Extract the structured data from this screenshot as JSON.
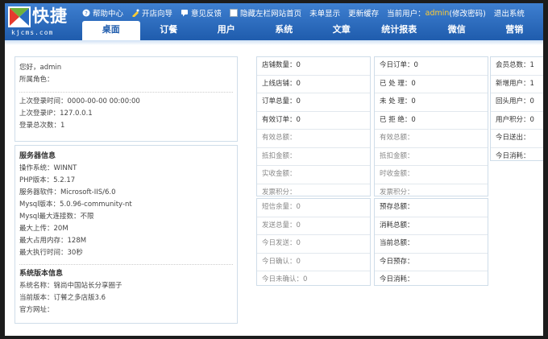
{
  "logo": {
    "name": "快捷",
    "sub": "kjcms.com"
  },
  "toplinks": [
    {
      "label": "帮助中心",
      "icon": "help-icon"
    },
    {
      "label": "开店向导",
      "icon": "wizard-icon"
    },
    {
      "label": "意见反馈",
      "icon": "feedback-icon"
    },
    {
      "label": "隐藏左栏",
      "icon": "checkbox-icon"
    },
    {
      "label": "网站首页"
    },
    {
      "label": "未单显示"
    },
    {
      "label": "更新缓存"
    }
  ],
  "user": {
    "prefix": "当前用户：",
    "name": "admin",
    "change_pwd": "(修改密码)",
    "logout": "退出系统"
  },
  "nav": [
    "桌面",
    "订餐",
    "用户",
    "系统",
    "文章",
    "统计报表",
    "微信",
    "营销"
  ],
  "welcome": {
    "greeting": "您好，admin",
    "role": "所属角色：",
    "last_login_time": "上次登录时间：0000-00-00 00:00:00",
    "last_login_ip": "上次登录IP：127.0.0.1",
    "login_count": "登录总次数：1"
  },
  "server": {
    "title": "服务器信息",
    "lines": [
      "操作系统：WINNT",
      "PHP版本：5.2.17",
      "服务器软件：Microsoft-IIS/6.0",
      "Mysql版本：5.0.96-community-nt",
      "Mysql最大连接数：不限",
      "最大上传：20M",
      "最大占用内存：128M",
      "最大执行时间：30秒"
    ]
  },
  "system": {
    "title": "系统版本信息",
    "lines": [
      "系统名称：锦尚中国站长分享圈子",
      "当前版本：订餐之多店版3.6",
      "官方网址："
    ]
  },
  "stats1": [
    {
      "label": "店铺数量：0",
      "dim": false
    },
    {
      "label": "上线店铺：0",
      "dim": false
    },
    {
      "label": "订单总量：0",
      "dim": false
    },
    {
      "label": "有效订单：0",
      "dim": false
    },
    {
      "label": "有效总额：",
      "dim": true
    },
    {
      "label": "抵扣金额：",
      "dim": true
    },
    {
      "label": "实收金额：",
      "dim": true
    },
    {
      "label": "发票积分：",
      "dim": true
    }
  ],
  "stats2": [
    {
      "label": "今日订单：0",
      "dim": false
    },
    {
      "label": "已 处 理：0",
      "dim": false
    },
    {
      "label": "未 处 理：0",
      "dim": false
    },
    {
      "label": "已 拒 绝：0",
      "dim": false
    },
    {
      "label": "有效总额：",
      "dim": true
    },
    {
      "label": "抵扣金额：",
      "dim": true
    },
    {
      "label": "时收金额：",
      "dim": true
    },
    {
      "label": "发票积分：",
      "dim": true
    }
  ],
  "stats3": [
    {
      "label": "会员总数：1",
      "dim": false
    },
    {
      "label": "新增用户：1",
      "dim": false
    },
    {
      "label": "回头用户：0",
      "dim": false
    },
    {
      "label": "用户积分：0",
      "dim": false
    },
    {
      "label": "今日送出：",
      "dim": false
    },
    {
      "label": "今日消耗：",
      "dim": false
    }
  ],
  "sms": [
    {
      "label": "短信余量：0",
      "dim": true
    },
    {
      "label": "发送总量：0",
      "dim": true
    },
    {
      "label": "今日发送：0",
      "dim": true
    },
    {
      "label": "今日确认：0",
      "dim": true
    },
    {
      "label": "今日未确认：0",
      "dim": true
    }
  ],
  "deposit": [
    {
      "label": "预存总额：",
      "dim": false
    },
    {
      "label": "消耗总额：",
      "dim": false
    },
    {
      "label": "当前总额：",
      "dim": false
    },
    {
      "label": "今日预存：",
      "dim": false
    },
    {
      "label": "今日消耗：",
      "dim": false
    }
  ],
  "colors": {
    "header": "#2b6cc0",
    "accent_user": "#ffcc33",
    "border": "#cfdde9"
  }
}
